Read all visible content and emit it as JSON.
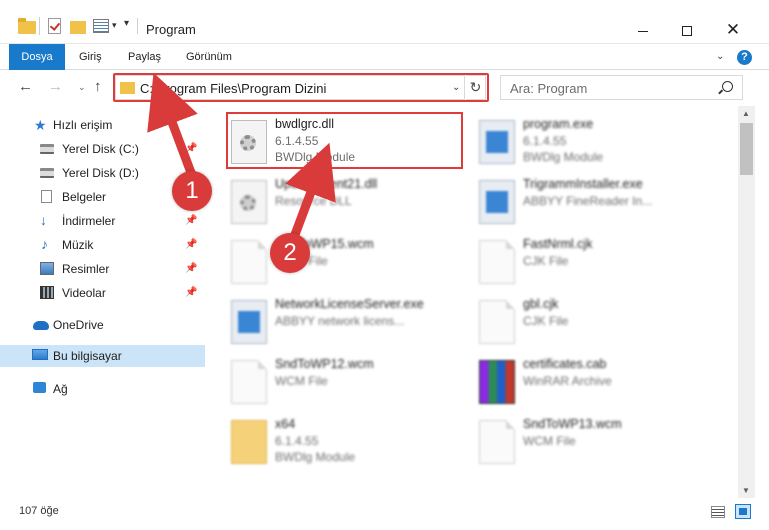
{
  "window": {
    "title": "Program",
    "minimize_glyph": "",
    "close_glyph": "✕"
  },
  "ribbon": {
    "tabs": [
      "Dosya",
      "Giriş",
      "Paylaş",
      "Görünüm"
    ],
    "help_glyph": "?",
    "expand_glyph": "⌄",
    "accent_color": "#1979ca"
  },
  "nav": {
    "back_glyph": "←",
    "forward_glyph": "→",
    "recent_glyph": "⌄",
    "up_glyph": "↑",
    "address": "C:\\Program Files\\Program Dizini",
    "address_dropdown_glyph": "⌄",
    "refresh_glyph": "↻",
    "search_placeholder": "Ara: Program"
  },
  "sidebar": {
    "items": [
      {
        "label": "Hızlı erişim",
        "icon": "star-icon"
      },
      {
        "label": "Yerel Disk (C:)",
        "icon": "drive-icon",
        "pinned": true
      },
      {
        "label": "Yerel Disk (D:)",
        "icon": "drive-icon"
      },
      {
        "label": "Belgeler",
        "icon": "documents-icon",
        "pinned": true
      },
      {
        "label": "İndirmeler",
        "icon": "downloads-icon",
        "pinned": true
      },
      {
        "label": "Müzik",
        "icon": "music-icon",
        "pinned": true
      },
      {
        "label": "Resimler",
        "icon": "pictures-icon",
        "pinned": true
      },
      {
        "label": "Videolar",
        "icon": "videos-icon",
        "pinned": true
      },
      {
        "label": "OneDrive",
        "icon": "cloud-icon"
      },
      {
        "label": "Bu bilgisayar",
        "icon": "computer-icon",
        "selected": true
      },
      {
        "label": "Ağ",
        "icon": "network-icon"
      }
    ],
    "pin_glyph": "📌"
  },
  "files": [
    {
      "name": "bwdlgrc.dll",
      "line2": "6.1.4.55",
      "line3": "BWDlg Module",
      "icon": "dll-icon",
      "blurred": false
    },
    {
      "name": "program.exe",
      "line2": "6.1.4.55",
      "line3": "BWDlg Module",
      "icon": "exe-icon",
      "blurred": true
    },
    {
      "name": "UpdateClient21.dll",
      "line2": "Resource DLL",
      "line3": "",
      "icon": "dll-icon",
      "blurred": true
    },
    {
      "name": "TrigrammInstaller.exe",
      "line2": "ABBYY FineReader In...",
      "line3": "",
      "icon": "exe-icon",
      "blurred": true
    },
    {
      "name": "SndToWP15.wcm",
      "line2": "WCM File",
      "line3": "",
      "icon": "file-icon",
      "blurred": true
    },
    {
      "name": "FastNrml.cjk",
      "line2": "CJK File",
      "line3": "",
      "icon": "file-icon",
      "blurred": true
    },
    {
      "name": "NetworkLicenseServer.exe",
      "line2": "ABBYY network licens...",
      "line3": "",
      "icon": "exe-icon",
      "blurred": true
    },
    {
      "name": "gbl.cjk",
      "line2": "CJK File",
      "line3": "",
      "icon": "file-icon",
      "blurred": true
    },
    {
      "name": "SndToWP12.wcm",
      "line2": "WCM File",
      "line3": "",
      "icon": "file-icon",
      "blurred": true
    },
    {
      "name": "certificates.cab",
      "line2": "WinRAR Archive",
      "line3": "",
      "icon": "archive-icon",
      "blurred": true
    },
    {
      "name": "x64",
      "line2": "6.1.4.55",
      "line3": "BWDlg Module",
      "icon": "folder-icon",
      "blurred": true
    },
    {
      "name": "SndToWP13.wcm",
      "line2": "WCM File",
      "line3": "",
      "icon": "file-icon",
      "blurred": true
    }
  ],
  "status": {
    "item_count": "107 öğe"
  },
  "annotations": {
    "step1": "1",
    "step2": "2",
    "highlight_color": "#e03b3b"
  }
}
